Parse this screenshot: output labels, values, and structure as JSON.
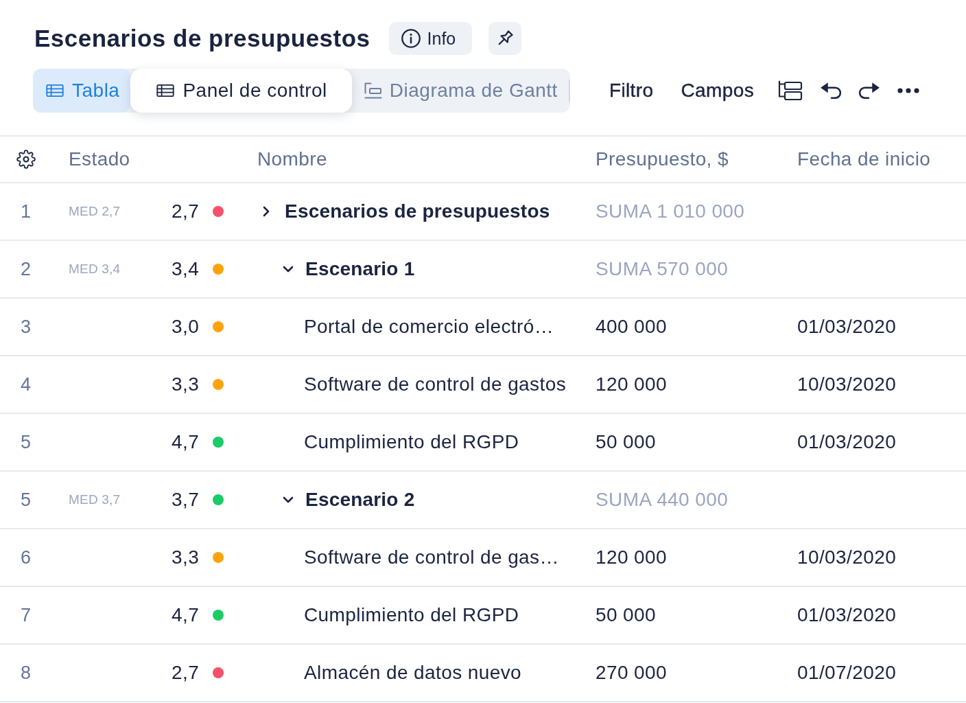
{
  "header": {
    "title": "Escenarios de presupuestos",
    "info_button": "Info"
  },
  "views": {
    "tabs": [
      {
        "label": "Tabla",
        "kind": "table",
        "selected": true,
        "raised": false
      },
      {
        "label": "Panel de control",
        "kind": "table",
        "selected": false,
        "raised": true
      },
      {
        "label": "Diagrama de Gantt",
        "kind": "gantt",
        "selected": false,
        "raised": false
      }
    ]
  },
  "toolbar": {
    "buttons": [
      "Filtro",
      "Campos"
    ]
  },
  "table": {
    "columns": [
      "Estado",
      "Nombre",
      "Presupuesto, $",
      "Fecha de inicio"
    ],
    "rows": [
      {
        "kind": "group",
        "number": "1",
        "average": "MED 2,7",
        "score": "2,7",
        "color": "#f5516b",
        "name": "Escenarios de presupuestos",
        "expanded": false,
        "budget": "SUMA 1 010 000",
        "children": [
          {
            "kind": "group",
            "number": "2",
            "average": "MED 3,4",
            "score": "3,4",
            "color": "#ffa30d",
            "name": "Escenario 1",
            "expanded": true,
            "budget": "SUMA 570 000",
            "children": [
              {
                "kind": "task",
                "number": "3",
                "score": "3,0",
                "color": "#ffa30d",
                "name": "Portal de comercio electró…",
                "budget": "400 000",
                "start_date": "01/03/2020"
              },
              {
                "kind": "task",
                "number": "4",
                "score": "3,3",
                "color": "#ffa30d",
                "name": "Software de control de gastos",
                "budget": "120 000",
                "start_date": "10/03/2020"
              },
              {
                "kind": "task",
                "number": "5",
                "score": "4,7",
                "color": "#1acb67",
                "name": "Cumplimiento del RGPD",
                "budget": "50 000",
                "start_date": "01/03/2020"
              }
            ]
          },
          {
            "kind": "group",
            "number": "5",
            "average": "MED 3,7",
            "score": "3,7",
            "color": "#1acb67",
            "name": "Escenario 2",
            "expanded": true,
            "budget": "SUMA 440 000",
            "children": [
              {
                "kind": "task",
                "number": "6",
                "score": "3,3",
                "color": "#ffa30d",
                "name": "Software de control de gas…",
                "budget": "120 000",
                "start_date": "10/03/2020"
              },
              {
                "kind": "task",
                "number": "7",
                "score": "4,7",
                "color": "#1acb67",
                "name": "Cumplimiento del RGPD",
                "budget": "50 000",
                "start_date": "01/03/2020"
              },
              {
                "kind": "task",
                "number": "8",
                "score": "2,7",
                "color": "#f5516b",
                "name": "Almacén de datos nuevo",
                "budget": "270 000",
                "start_date": "01/07/2020"
              }
            ]
          }
        ]
      }
    ]
  }
}
